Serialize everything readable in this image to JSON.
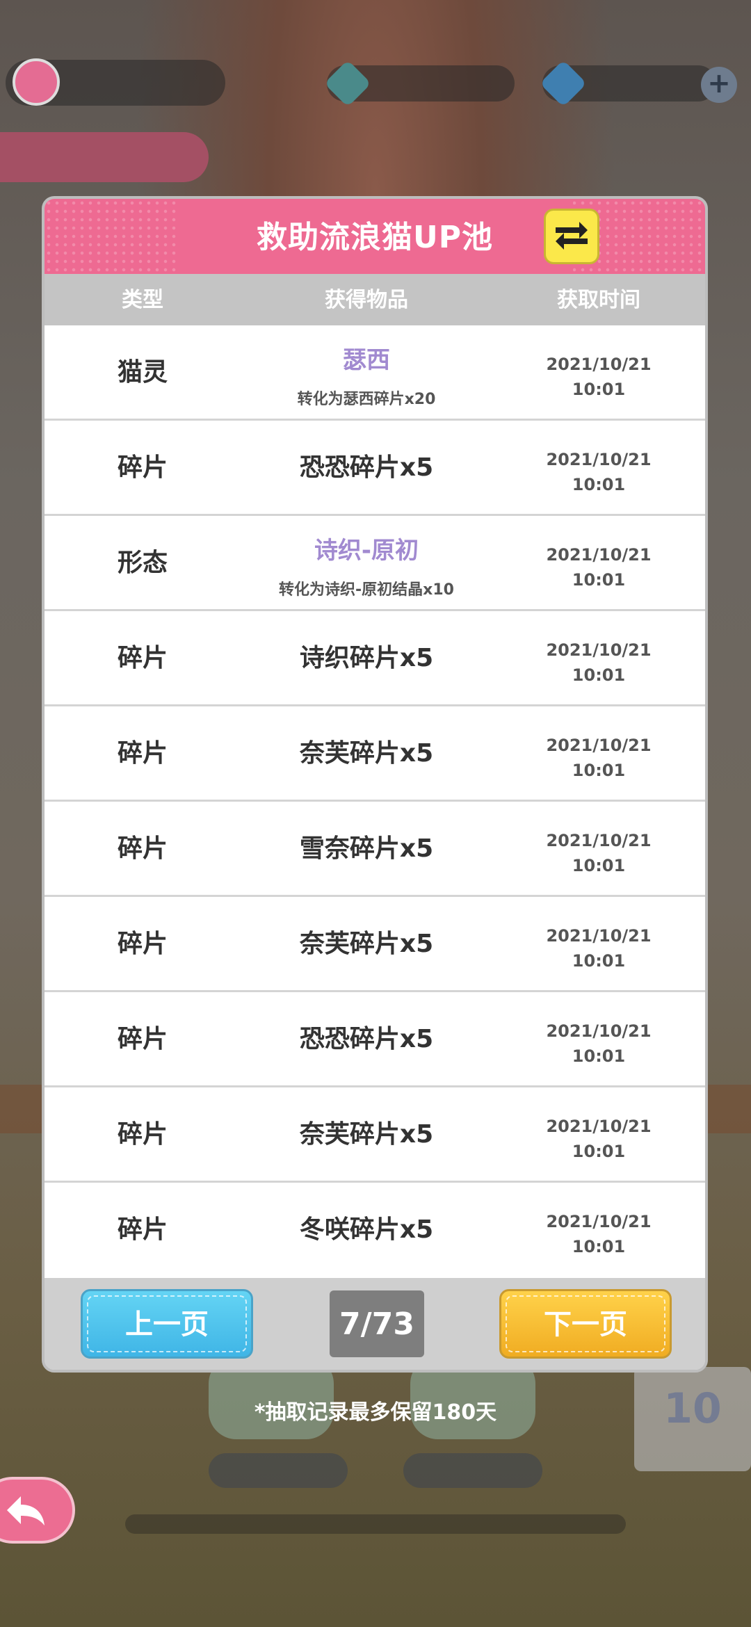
{
  "dialog": {
    "title": "救助流浪猫UP池",
    "columns": [
      "类型",
      "获得物品",
      "获取时间"
    ],
    "rows": [
      {
        "type": "猫灵",
        "item": "瑟西",
        "sub": "转化为瑟西碎片x20",
        "date": "2021/10/21",
        "time": "10:01"
      },
      {
        "type": "碎片",
        "item": "恐恐碎片x5",
        "sub": "",
        "date": "2021/10/21",
        "time": "10:01"
      },
      {
        "type": "形态",
        "item": "诗织-原初",
        "sub": "转化为诗织-原初结晶x10",
        "date": "2021/10/21",
        "time": "10:01"
      },
      {
        "type": "碎片",
        "item": "诗织碎片x5",
        "sub": "",
        "date": "2021/10/21",
        "time": "10:01"
      },
      {
        "type": "碎片",
        "item": "奈芙碎片x5",
        "sub": "",
        "date": "2021/10/21",
        "time": "10:01"
      },
      {
        "type": "碎片",
        "item": "雪奈碎片x5",
        "sub": "",
        "date": "2021/10/21",
        "time": "10:01"
      },
      {
        "type": "碎片",
        "item": "奈芙碎片x5",
        "sub": "",
        "date": "2021/10/21",
        "time": "10:01"
      },
      {
        "type": "碎片",
        "item": "恐恐碎片x5",
        "sub": "",
        "date": "2021/10/21",
        "time": "10:01"
      },
      {
        "type": "碎片",
        "item": "奈芙碎片x5",
        "sub": "",
        "date": "2021/10/21",
        "time": "10:01"
      },
      {
        "type": "碎片",
        "item": "冬咲碎片x5",
        "sub": "",
        "date": "2021/10/21",
        "time": "10:01"
      }
    ],
    "prev_label": "上一页",
    "next_label": "下一页",
    "page": "7/73"
  },
  "note": "*抽取记录最多保留180天",
  "colors": {
    "title_pink": "#ee6a92",
    "rare_purple": "#a18ad0",
    "prev_blue": "#3fb5e6",
    "next_orange": "#f0ac22",
    "swap_yellow": "#fbe84a"
  },
  "icons": {
    "swap": "swap-arrows-icon",
    "back": "back-arrow-icon"
  }
}
